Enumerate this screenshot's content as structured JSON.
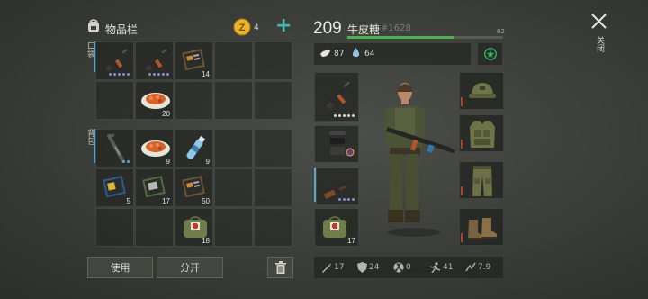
{
  "header": {
    "title": "物品栏",
    "coins": "4",
    "plus": "+"
  },
  "sections": {
    "pockets": "口袋",
    "backpack": "背包"
  },
  "pocket_slots": [
    {
      "icon": "assault-rifle-icon",
      "qty": "",
      "dots": 5
    },
    {
      "icon": "assault-rifle-icon",
      "qty": "",
      "dots": 5
    },
    {
      "icon": "book-icon",
      "qty": "14",
      "dots": 0
    },
    {
      "icon": "",
      "qty": ""
    },
    {
      "icon": "",
      "qty": ""
    },
    {
      "icon": "",
      "qty": ""
    },
    {
      "icon": "food-plate-icon",
      "qty": "20"
    },
    {
      "icon": "",
      "qty": ""
    },
    {
      "icon": "",
      "qty": ""
    },
    {
      "icon": "",
      "qty": ""
    }
  ],
  "backpack_slots": [
    {
      "icon": "crowbar-icon",
      "qty": "",
      "dots": 2
    },
    {
      "icon": "food-plate-icon",
      "qty": "9"
    },
    {
      "icon": "water-bottle-icon",
      "qty": "9"
    },
    {
      "icon": "",
      "qty": ""
    },
    {
      "icon": "",
      "qty": ""
    },
    {
      "icon": "book-icon",
      "qty": "5"
    },
    {
      "icon": "book-icon",
      "qty": "17"
    },
    {
      "icon": "book-icon",
      "qty": "50"
    },
    {
      "icon": "",
      "qty": ""
    },
    {
      "icon": "",
      "qty": ""
    },
    {
      "icon": "",
      "qty": ""
    },
    {
      "icon": "",
      "qty": ""
    },
    {
      "icon": "medkit-bag-icon",
      "qty": "18"
    },
    {
      "icon": "",
      "qty": ""
    },
    {
      "icon": "",
      "qty": ""
    }
  ],
  "buttons": {
    "use": "使用",
    "split": "分开"
  },
  "player": {
    "level": "209",
    "name": "牛皮糖",
    "id": "#1628",
    "xp_value": "82",
    "xp_fraction": 0.82,
    "food": "87",
    "water": "64"
  },
  "weapon_slots": [
    {
      "icon": "assault-rifle-icon",
      "qty": "",
      "dots": 5
    },
    {
      "icon": "tactical-backpack-icon",
      "qty": ""
    },
    {
      "icon": "shotgun-icon",
      "qty": "",
      "dots": 4
    },
    {
      "icon": "medkit-bag-icon",
      "qty": "17"
    }
  ],
  "armor_slots": [
    {
      "icon": "cap-icon"
    },
    {
      "icon": "vest-icon"
    },
    {
      "icon": "pants-icon"
    },
    {
      "icon": "boots-icon"
    }
  ],
  "stats": [
    {
      "icon": "attack-icon",
      "value": "17"
    },
    {
      "icon": "armor-icon",
      "value": "24"
    },
    {
      "icon": "radiation-icon",
      "value": "0"
    },
    {
      "icon": "speed-icon",
      "value": "41"
    },
    {
      "icon": "weight-icon",
      "value": "7.9"
    }
  ],
  "close": {
    "label": "关闭"
  },
  "colors": {
    "xp": "#4fb24c",
    "accent": "#44b8b5",
    "coin": "#e7b42b"
  }
}
